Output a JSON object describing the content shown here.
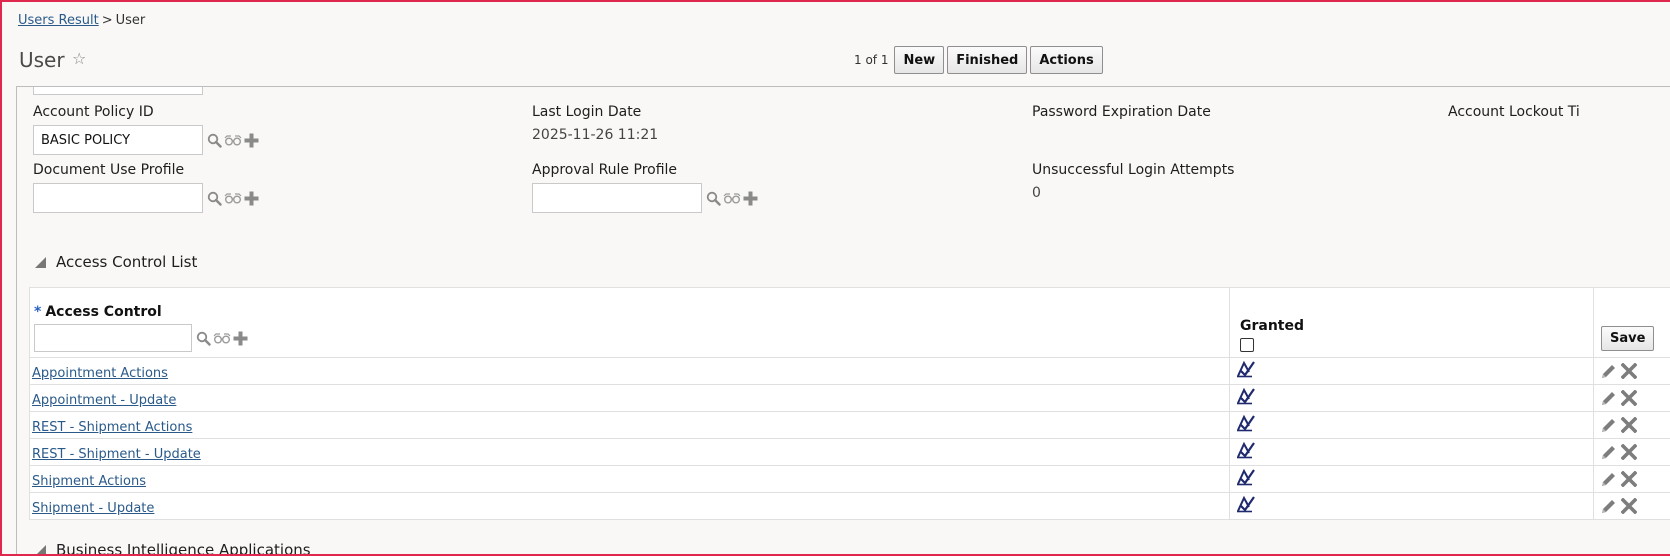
{
  "breadcrumb": {
    "parent": "Users Result",
    "separator": ">",
    "current": "User"
  },
  "header": {
    "title": "User",
    "pager": "1 of 1",
    "buttons": {
      "new": "New",
      "finished": "Finished",
      "actions": "Actions"
    }
  },
  "fields": {
    "account_policy": {
      "label": "Account Policy ID",
      "value": "BASIC POLICY"
    },
    "last_login": {
      "label": "Last Login Date",
      "value": "2025-11-26 11:21"
    },
    "password_expiration": {
      "label": "Password Expiration Date",
      "value": ""
    },
    "account_lockout": {
      "label": "Account Lockout Ti",
      "value": ""
    },
    "document_use_profile": {
      "label": "Document Use Profile",
      "value": ""
    },
    "approval_rule_profile": {
      "label": "Approval Rule Profile",
      "value": ""
    },
    "unsuccessful_logins": {
      "label": "Unsuccessful Login Attempts",
      "value": "0"
    }
  },
  "acl_section": {
    "title": "Access Control List",
    "columns": {
      "access_control": "Access Control",
      "required_mark": "*",
      "granted": "Granted"
    },
    "new_access_control": "",
    "save_label": "Save",
    "rows": [
      {
        "name": "Appointment Actions"
      },
      {
        "name": "Appointment - Update"
      },
      {
        "name": "REST - Shipment Actions"
      },
      {
        "name": "REST - Shipment - Update"
      },
      {
        "name": "Shipment Actions"
      },
      {
        "name": "Shipment - Update"
      }
    ]
  },
  "next_section": {
    "title": "Business Intelligence Applications"
  },
  "icons": {
    "star": "star-icon",
    "search": "search-icon",
    "view": "glasses-icon",
    "add": "plus-icon",
    "granted": "granted-checkmark-icon",
    "edit": "pencil-icon",
    "delete": "close-icon"
  },
  "colors": {
    "link": "#2a5a8a",
    "frame_border": "#e0284f",
    "granted_icon": "#1f2a6e",
    "required": "#2962c4"
  }
}
